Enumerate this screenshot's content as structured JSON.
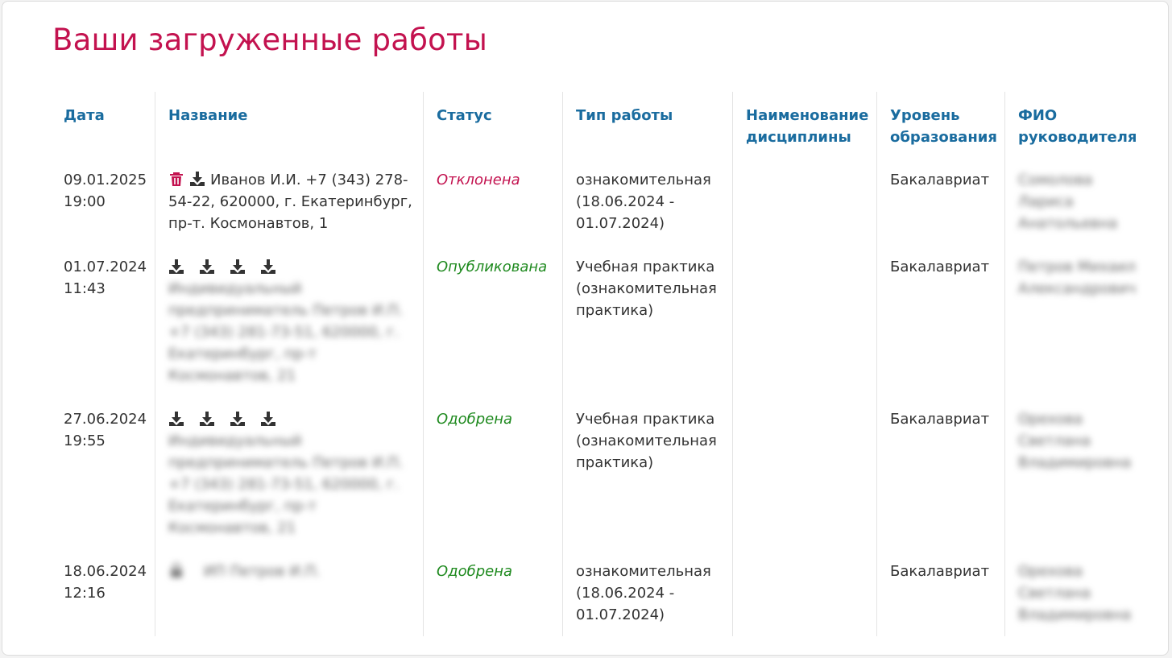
{
  "page": {
    "title": "Ваши загруженные работы"
  },
  "colors": {
    "title": "#c3124f",
    "header": "#1a6c9f",
    "status_rejected": "#c3124f",
    "status_ok": "#1f8a1f"
  },
  "table": {
    "headers": {
      "date": "Дата",
      "name": "Название",
      "status": "Статус",
      "type": "Тип работы",
      "discipline": "Наименование дисциплины",
      "level": "Уровень образования",
      "supervisor": "ФИО руководителя"
    },
    "rows": [
      {
        "date": "09.01.2025",
        "time": "19:00",
        "icons": [
          "trash-icon",
          "download-icon"
        ],
        "name": "Иванов И.И. +7 (343) 278-54-22, 620000, г. Екатеринбург, пр-т. Космонавтов, 1",
        "status": "Отклонена",
        "status_color": "#c3124f",
        "type": "ознакомительная (18.06.2024 - 01.07.2024)",
        "discipline": "",
        "level": "Бакалавриат",
        "supervisor": "Сомолова Лариса Анатольевна"
      },
      {
        "date": "01.07.2024",
        "time": "11:43",
        "icons": [
          "download-icon",
          "download-icon",
          "download-icon",
          "download-icon"
        ],
        "name": "Индивидуальный предприниматель Петров И.П. +7 (343) 281-73-51, 620000, г. Екатеринбург, пр-т Космонавтов, 21",
        "status": "Опубликована",
        "status_color": "#1f8a1f",
        "type": "Учебная практика (ознакомительная практика)",
        "discipline": "",
        "level": "Бакалавриат",
        "supervisor": "Петров Михаил Александрович"
      },
      {
        "date": "27.06.2024",
        "time": "19:55",
        "icons": [
          "download-icon",
          "download-icon",
          "download-icon",
          "download-icon"
        ],
        "name": "Индивидуальный предприниматель Петров И.П. +7 (343) 281-73-51, 620000, г. Екатеринбург, пр-т Космонавтов, 21",
        "status": "Одобрена",
        "status_color": "#1f8a1f",
        "type": "Учебная практика (ознакомительная практика)",
        "discipline": "",
        "level": "Бакалавриат",
        "supervisor": "Орехова Светлана Владимировна"
      },
      {
        "date": "18.06.2024",
        "time": "12:16",
        "icons": [
          "lock-icon"
        ],
        "name": "ИП Петров И.П.",
        "status": "Одобрена",
        "status_color": "#1f8a1f",
        "type": "ознакомительная (18.06.2024 - 01.07.2024)",
        "discipline": "",
        "level": "Бакалавриат",
        "supervisor": "Орехова Светлана Владимировна"
      }
    ]
  }
}
